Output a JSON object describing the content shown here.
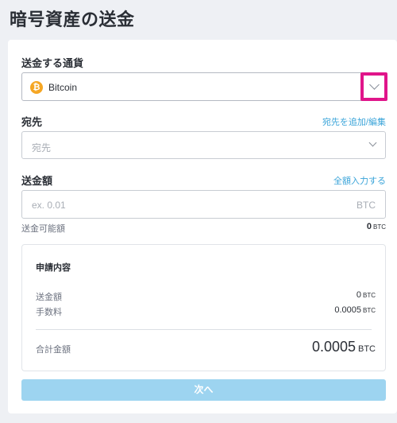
{
  "page": {
    "title": "暗号資産の送金"
  },
  "currency": {
    "label": "送金する通貨",
    "selected": "Bitcoin",
    "icon": "bitcoin-icon",
    "icon_glyph": "₿",
    "icon_color": "#f5a623"
  },
  "destination": {
    "label": "宛先",
    "add_edit_link": "宛先を追加/編集",
    "placeholder": "宛先"
  },
  "amount": {
    "label": "送金額",
    "send_all_link": "全額入力する",
    "placeholder": "ex. 0.01",
    "unit": "BTC"
  },
  "available": {
    "label": "送金可能額",
    "value": "0",
    "unit": "BTC"
  },
  "summary": {
    "title": "申請内容",
    "send_amount_label": "送金額",
    "send_amount_value": "0",
    "send_amount_unit": "BTC",
    "fee_label": "手数料",
    "fee_value": "0.0005",
    "fee_unit": "BTC",
    "total_label": "合計金額",
    "total_value": "0.0005",
    "total_unit": "BTC"
  },
  "next_button": {
    "label": "次へ"
  },
  "colors": {
    "accent": "#3aa4d9",
    "highlight": "#e0158a",
    "button_disabled": "#9dd4f0"
  }
}
